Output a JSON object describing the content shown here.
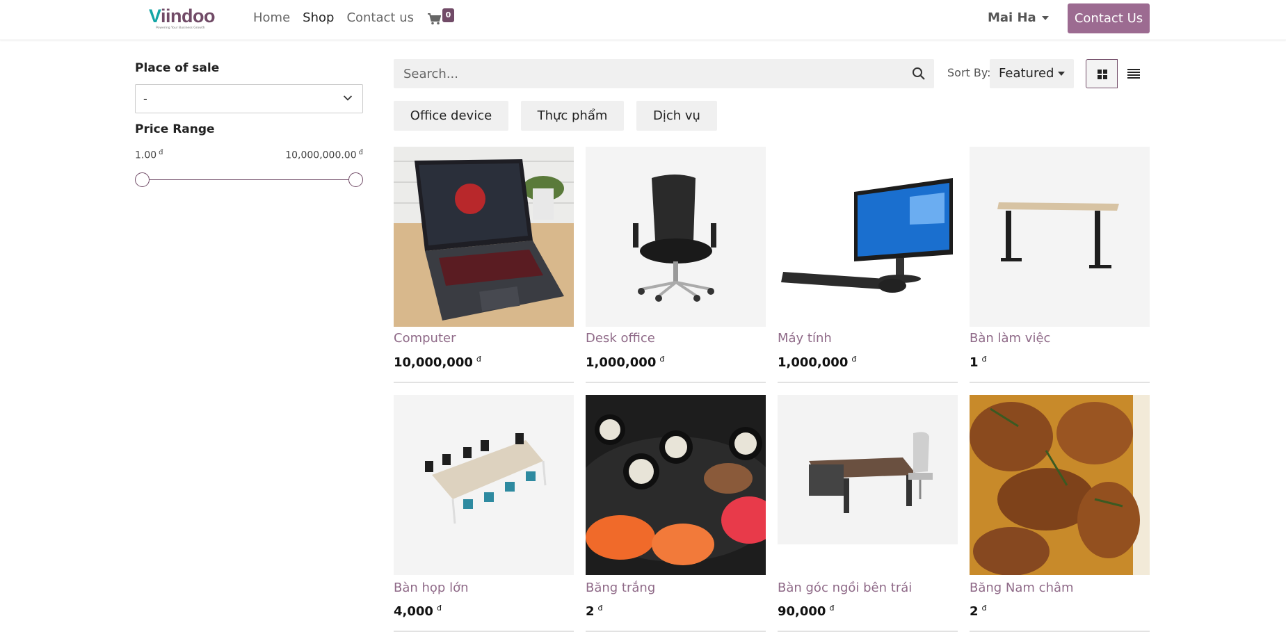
{
  "brand": {
    "name_v": "V",
    "name_rest": "iindoo",
    "tagline": "Powering Your Business Growth"
  },
  "nav": {
    "home": "Home",
    "shop": "Shop",
    "contact": "Contact us"
  },
  "cart": {
    "count": "0"
  },
  "user": {
    "name": "Mai Ha"
  },
  "header_cta": "Contact Us",
  "sidebar": {
    "place_title": "Place of sale",
    "place_value": "-",
    "price_title": "Price Range",
    "price_min": "1.00",
    "price_max": "10,000,000.00",
    "currency": "đ"
  },
  "toolbar": {
    "search_placeholder": "Search...",
    "sort_label": "Sort By:",
    "sort_value": "Featured"
  },
  "categories": [
    "Office device",
    "Thực phẩm",
    "Dịch vụ"
  ],
  "products": [
    {
      "name": "Computer",
      "price": "10,000,000"
    },
    {
      "name": "Desk office",
      "price": "1,000,000"
    },
    {
      "name": "Máy tính",
      "price": "1,000,000"
    },
    {
      "name": "Bàn làm việc",
      "price": "1"
    },
    {
      "name": "Bàn họp lớn",
      "price": "4,000"
    },
    {
      "name": "Băng trắng",
      "price": "2"
    },
    {
      "name": "Bàn góc ngồi bên trái",
      "price": "90,000"
    },
    {
      "name": "Băng Nam châm",
      "price": "2"
    }
  ],
  "colors": {
    "accent": "#714b67",
    "button": "#9c6b91",
    "product_name": "#8f6a88",
    "logo_teal": "#14a6a6"
  }
}
